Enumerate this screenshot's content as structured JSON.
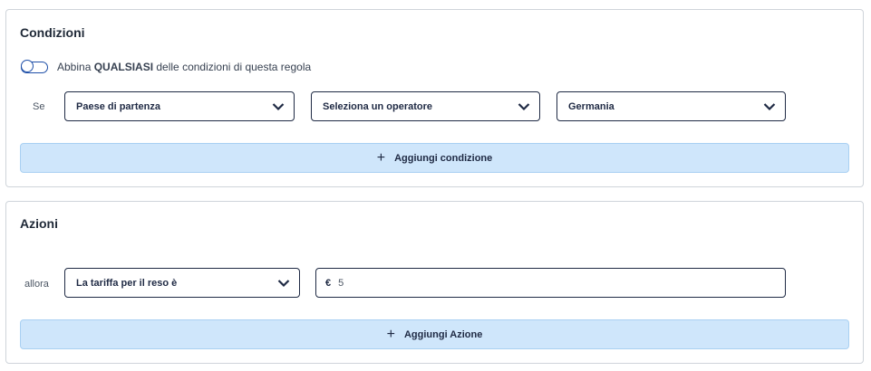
{
  "conditions": {
    "title": "Condizioni",
    "toggle_text_before": "Abbina ",
    "toggle_text_strong": "QUALSIASI",
    "toggle_text_after": " delle condizioni di questa regola",
    "row_label": "Se",
    "field_select": "Paese di partenza",
    "operator_select": "Seleziona un operatore",
    "value_select": "Germania",
    "add_button": "Aggiungi condizione"
  },
  "actions": {
    "title": "Azioni",
    "row_label": "allora",
    "action_select": "La tariffa per il reso è",
    "currency_prefix": "€",
    "amount_value": "5",
    "add_button": "Aggiungi Azione"
  }
}
